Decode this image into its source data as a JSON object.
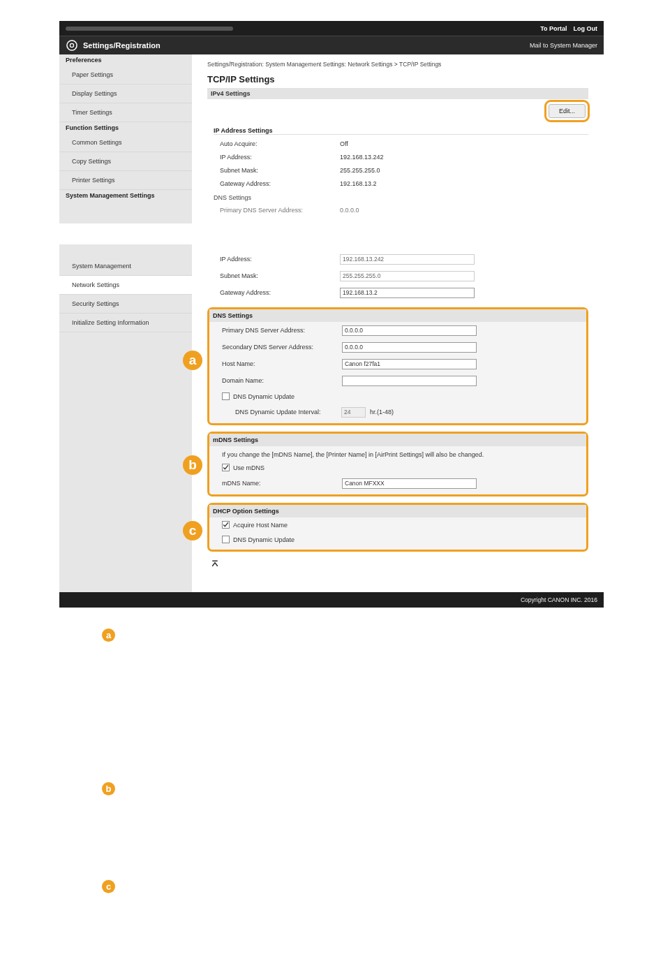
{
  "top_screenshot": {
    "header_links": [
      "To Portal",
      "Log Out"
    ],
    "title": "Settings/Registration",
    "mail_link": "Mail to System Manager",
    "sidebar": [
      {
        "kind": "header",
        "label": "Preferences"
      },
      {
        "kind": "item",
        "label": "Paper Settings",
        "selected": false
      },
      {
        "kind": "item",
        "label": "Display Settings",
        "selected": false
      },
      {
        "kind": "item",
        "label": "Timer Settings",
        "selected": false
      },
      {
        "kind": "header",
        "label": "Function Settings"
      },
      {
        "kind": "item",
        "label": "Common Settings",
        "selected": false
      },
      {
        "kind": "item",
        "label": "Copy Settings",
        "selected": false
      },
      {
        "kind": "item",
        "label": "Printer Settings",
        "selected": false
      },
      {
        "kind": "header",
        "label": "System Management Settings"
      }
    ],
    "breadcrumb": "Settings/Registration: System Management Settings: Network Settings > TCP/IP Settings",
    "heading": "TCP/IP Settings",
    "section": "IPv4 Settings",
    "edit_button": "Edit...",
    "ip_title": "IP Address Settings",
    "ip_rows": [
      {
        "label": "Auto Acquire:",
        "value": "Off"
      },
      {
        "label": "IP Address:",
        "value": "192.168.13.242"
      },
      {
        "label": "Subnet Mask:",
        "value": "255.255.255.0"
      },
      {
        "label": "Gateway Address:",
        "value": "192.168.13.2"
      }
    ],
    "dns_title": "DNS Settings",
    "dns_rows": [
      {
        "label": "Primary DNS Server Address:",
        "value": "0.0.0.0"
      }
    ]
  },
  "bottom_screenshot": {
    "sidebar": [
      {
        "kind": "item",
        "label": "System Management",
        "selected": false
      },
      {
        "kind": "item",
        "label": "Network Settings",
        "selected": true
      },
      {
        "kind": "item",
        "label": "Security Settings",
        "selected": false
      },
      {
        "kind": "item",
        "label": "Initialize Setting Information",
        "selected": false
      }
    ],
    "ip_fields": [
      {
        "label": "IP Address:",
        "value": "192.168.13.242",
        "disabled": true
      },
      {
        "label": "Subnet Mask:",
        "value": "255.255.255.0",
        "disabled": true
      },
      {
        "label": "Gateway Address:",
        "value": "192.168.13.2",
        "disabled": false
      }
    ],
    "groups": [
      {
        "marker": "a",
        "title": "DNS Settings",
        "rows": [
          {
            "kind": "field",
            "label": "Primary DNS Server Address:",
            "value": "0.0.0.0"
          },
          {
            "kind": "field",
            "label": "Secondary DNS Server Address:",
            "value": "0.0.0.0"
          },
          {
            "kind": "field",
            "label": "Host Name:",
            "value": "Canon f27fa1"
          },
          {
            "kind": "field",
            "label": "Domain Name:"
          },
          {
            "kind": "checkbox",
            "label": "DNS Dynamic Update",
            "checked": false
          },
          {
            "kind": "interval",
            "label": "DNS Dynamic Update Interval:",
            "value": "24",
            "unit": "hr.(1-48)"
          }
        ]
      },
      {
        "marker": "b",
        "title": "mDNS Settings",
        "rows": [
          {
            "kind": "note",
            "text": "If you change the [mDNS Name], the [Printer Name] in [AirPrint Settings] will also be changed."
          },
          {
            "kind": "checkbox",
            "label": "Use mDNS",
            "checked": true
          },
          {
            "kind": "field",
            "label": "mDNS Name:",
            "value": "Canon MFXXX"
          }
        ]
      },
      {
        "marker": "c",
        "title": "DHCP Option Settings",
        "rows": [
          {
            "kind": "checkbox",
            "label": "Acquire Host Name",
            "checked": true
          },
          {
            "kind": "checkbox",
            "label": "DNS Dynamic Update",
            "checked": false
          }
        ]
      }
    ],
    "footer": "Copyright CANON INC. 2016"
  },
  "callouts": [
    {
      "marker": "a"
    },
    {
      "marker": "b"
    },
    {
      "marker": "c"
    }
  ]
}
